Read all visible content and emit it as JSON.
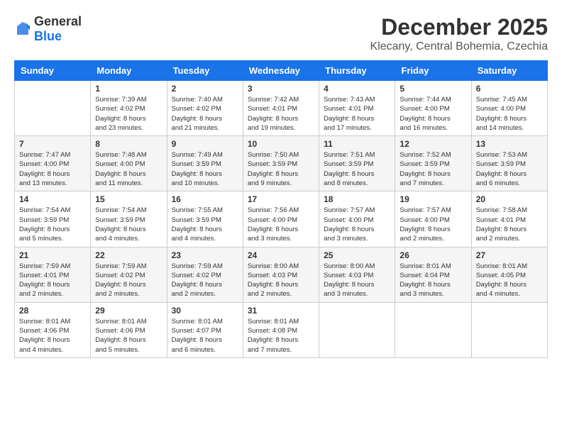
{
  "header": {
    "logo_general": "General",
    "logo_blue": "Blue",
    "month": "December 2025",
    "location": "Klecany, Central Bohemia, Czechia"
  },
  "weekdays": [
    "Sunday",
    "Monday",
    "Tuesday",
    "Wednesday",
    "Thursday",
    "Friday",
    "Saturday"
  ],
  "weeks": [
    [
      {
        "day": "",
        "info": ""
      },
      {
        "day": "1",
        "info": "Sunrise: 7:39 AM\nSunset: 4:02 PM\nDaylight: 8 hours\nand 23 minutes."
      },
      {
        "day": "2",
        "info": "Sunrise: 7:40 AM\nSunset: 4:02 PM\nDaylight: 8 hours\nand 21 minutes."
      },
      {
        "day": "3",
        "info": "Sunrise: 7:42 AM\nSunset: 4:01 PM\nDaylight: 8 hours\nand 19 minutes."
      },
      {
        "day": "4",
        "info": "Sunrise: 7:43 AM\nSunset: 4:01 PM\nDaylight: 8 hours\nand 17 minutes."
      },
      {
        "day": "5",
        "info": "Sunrise: 7:44 AM\nSunset: 4:00 PM\nDaylight: 8 hours\nand 16 minutes."
      },
      {
        "day": "6",
        "info": "Sunrise: 7:45 AM\nSunset: 4:00 PM\nDaylight: 8 hours\nand 14 minutes."
      }
    ],
    [
      {
        "day": "7",
        "info": "Sunrise: 7:47 AM\nSunset: 4:00 PM\nDaylight: 8 hours\nand 13 minutes."
      },
      {
        "day": "8",
        "info": "Sunrise: 7:48 AM\nSunset: 4:00 PM\nDaylight: 8 hours\nand 11 minutes."
      },
      {
        "day": "9",
        "info": "Sunrise: 7:49 AM\nSunset: 3:59 PM\nDaylight: 8 hours\nand 10 minutes."
      },
      {
        "day": "10",
        "info": "Sunrise: 7:50 AM\nSunset: 3:59 PM\nDaylight: 8 hours\nand 9 minutes."
      },
      {
        "day": "11",
        "info": "Sunrise: 7:51 AM\nSunset: 3:59 PM\nDaylight: 8 hours\nand 8 minutes."
      },
      {
        "day": "12",
        "info": "Sunrise: 7:52 AM\nSunset: 3:59 PM\nDaylight: 8 hours\nand 7 minutes."
      },
      {
        "day": "13",
        "info": "Sunrise: 7:53 AM\nSunset: 3:59 PM\nDaylight: 8 hours\nand 6 minutes."
      }
    ],
    [
      {
        "day": "14",
        "info": "Sunrise: 7:54 AM\nSunset: 3:59 PM\nDaylight: 8 hours\nand 5 minutes."
      },
      {
        "day": "15",
        "info": "Sunrise: 7:54 AM\nSunset: 3:59 PM\nDaylight: 8 hours\nand 4 minutes."
      },
      {
        "day": "16",
        "info": "Sunrise: 7:55 AM\nSunset: 3:59 PM\nDaylight: 8 hours\nand 4 minutes."
      },
      {
        "day": "17",
        "info": "Sunrise: 7:56 AM\nSunset: 4:00 PM\nDaylight: 8 hours\nand 3 minutes."
      },
      {
        "day": "18",
        "info": "Sunrise: 7:57 AM\nSunset: 4:00 PM\nDaylight: 8 hours\nand 3 minutes."
      },
      {
        "day": "19",
        "info": "Sunrise: 7:57 AM\nSunset: 4:00 PM\nDaylight: 8 hours\nand 2 minutes."
      },
      {
        "day": "20",
        "info": "Sunrise: 7:58 AM\nSunset: 4:01 PM\nDaylight: 8 hours\nand 2 minutes."
      }
    ],
    [
      {
        "day": "21",
        "info": "Sunrise: 7:59 AM\nSunset: 4:01 PM\nDaylight: 8 hours\nand 2 minutes."
      },
      {
        "day": "22",
        "info": "Sunrise: 7:59 AM\nSunset: 4:02 PM\nDaylight: 8 hours\nand 2 minutes."
      },
      {
        "day": "23",
        "info": "Sunrise: 7:59 AM\nSunset: 4:02 PM\nDaylight: 8 hours\nand 2 minutes."
      },
      {
        "day": "24",
        "info": "Sunrise: 8:00 AM\nSunset: 4:03 PM\nDaylight: 8 hours\nand 2 minutes."
      },
      {
        "day": "25",
        "info": "Sunrise: 8:00 AM\nSunset: 4:03 PM\nDaylight: 8 hours\nand 3 minutes."
      },
      {
        "day": "26",
        "info": "Sunrise: 8:01 AM\nSunset: 4:04 PM\nDaylight: 8 hours\nand 3 minutes."
      },
      {
        "day": "27",
        "info": "Sunrise: 8:01 AM\nSunset: 4:05 PM\nDaylight: 8 hours\nand 4 minutes."
      }
    ],
    [
      {
        "day": "28",
        "info": "Sunrise: 8:01 AM\nSunset: 4:06 PM\nDaylight: 8 hours\nand 4 minutes."
      },
      {
        "day": "29",
        "info": "Sunrise: 8:01 AM\nSunset: 4:06 PM\nDaylight: 8 hours\nand 5 minutes."
      },
      {
        "day": "30",
        "info": "Sunrise: 8:01 AM\nSunset: 4:07 PM\nDaylight: 8 hours\nand 6 minutes."
      },
      {
        "day": "31",
        "info": "Sunrise: 8:01 AM\nSunset: 4:08 PM\nDaylight: 8 hours\nand 7 minutes."
      },
      {
        "day": "",
        "info": ""
      },
      {
        "day": "",
        "info": ""
      },
      {
        "day": "",
        "info": ""
      }
    ]
  ]
}
